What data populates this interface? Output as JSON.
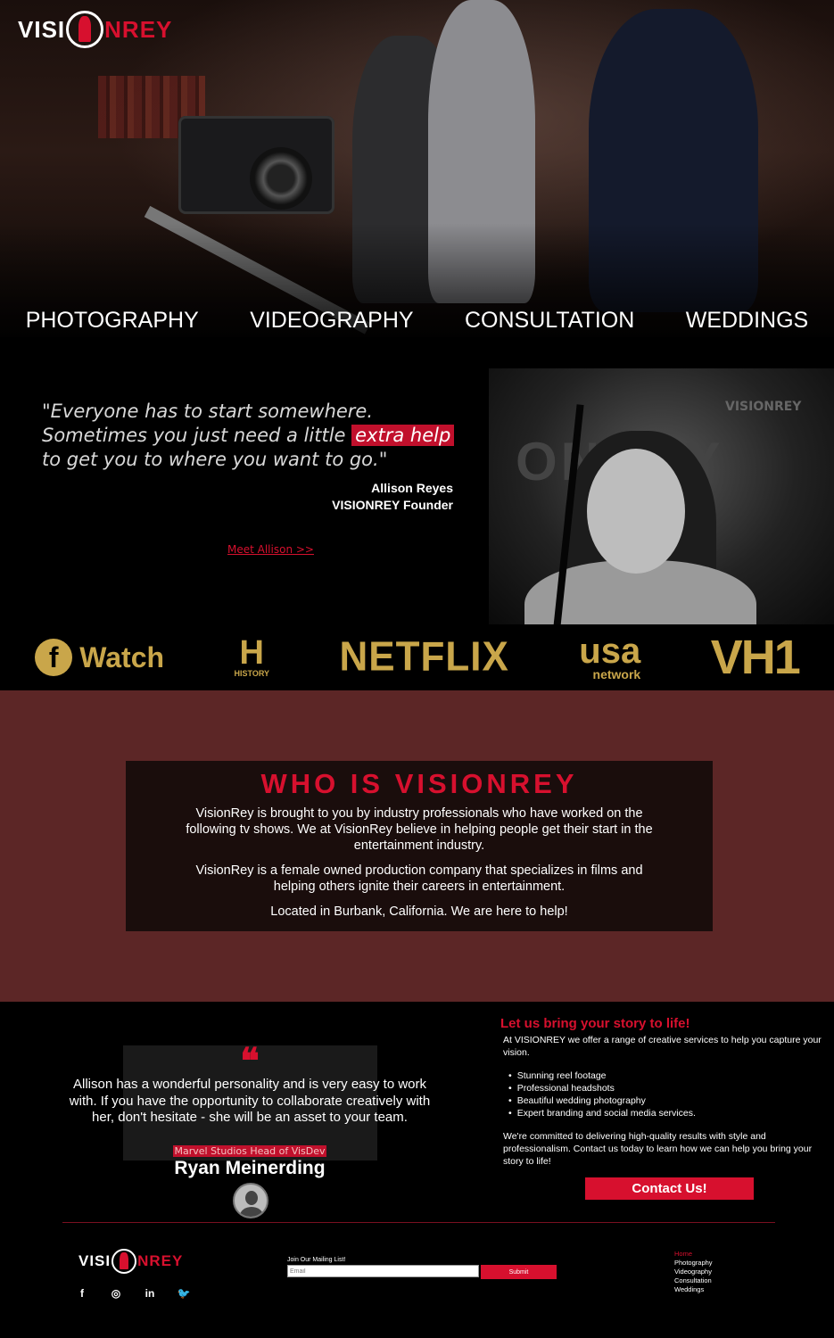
{
  "brand": {
    "logo_left": "VISI",
    "logo_right": "NREY"
  },
  "services_nav": [
    "PHOTOGRAPHY",
    "VIDEOGRAPHY",
    "CONSULTATION",
    "WEDDINGS"
  ],
  "quote": {
    "line1": "\"Everyone has to start somewhere.",
    "line2_pre": "Sometimes you just need a little ",
    "line2_highlight": "extra help",
    "line3": "to get you to where you want to go.\"",
    "author_name": "Allison Reyes",
    "author_title": "VISIONREY Founder",
    "meet_link": "Meet Allison >>"
  },
  "photo_banner": {
    "text": "ONREY",
    "logo": "VISIONREY"
  },
  "networks": {
    "watch": "Watch",
    "history_mark": "H",
    "history_name": "HISTORY",
    "netflix": "NETFLIX",
    "usa": "usa",
    "usa_sub": "network",
    "vh1": "VH1"
  },
  "who": {
    "title": "WHO IS VISIONREY",
    "p1": "VisionRey is brought to you by industry professionals who have worked on the following tv shows. We at VisionRey believe in helping people get their start in the entertainment industry.",
    "p2": "VisionRey is a female owned production company that specializes in films and helping others ignite their careers in entertainment.",
    "p3": "Located in Burbank, California. We are here to help!"
  },
  "testimonial": {
    "quote_mark": "❝",
    "text": "Allison has a wonderful personality and is very easy to work with. If you have the opportunity to collaborate creatively with her, don't hesitate - she will be an asset to your team.",
    "role": "Marvel Studios Head of VisDev",
    "name": "Ryan Meinerding"
  },
  "services": {
    "title": "Let us bring your story to life!",
    "intro": "At VISIONREY we offer a range of creative services to help you capture your vision.",
    "items": [
      "Stunning reel footage",
      "Professional headshots",
      "Beautiful wedding photography",
      "Expert branding and social media services."
    ],
    "outro": "We're committed to delivering high-quality results with style and professionalism. Contact us today to learn how we can help you bring your story to life!",
    "contact_button": "Contact Us!"
  },
  "footer": {
    "socials": [
      "f",
      "◎",
      "in",
      "🐦"
    ],
    "mailing_label": "Join Our Mailing List!",
    "email_placeholder": "Email",
    "submit_label": "Submit",
    "nav": [
      "Home",
      "Photography",
      "Videography",
      "Consultation",
      "Weddings"
    ]
  },
  "colors": {
    "accent": "#d7102e",
    "maroon": "#5c2626",
    "gold": "#c9a64a"
  }
}
